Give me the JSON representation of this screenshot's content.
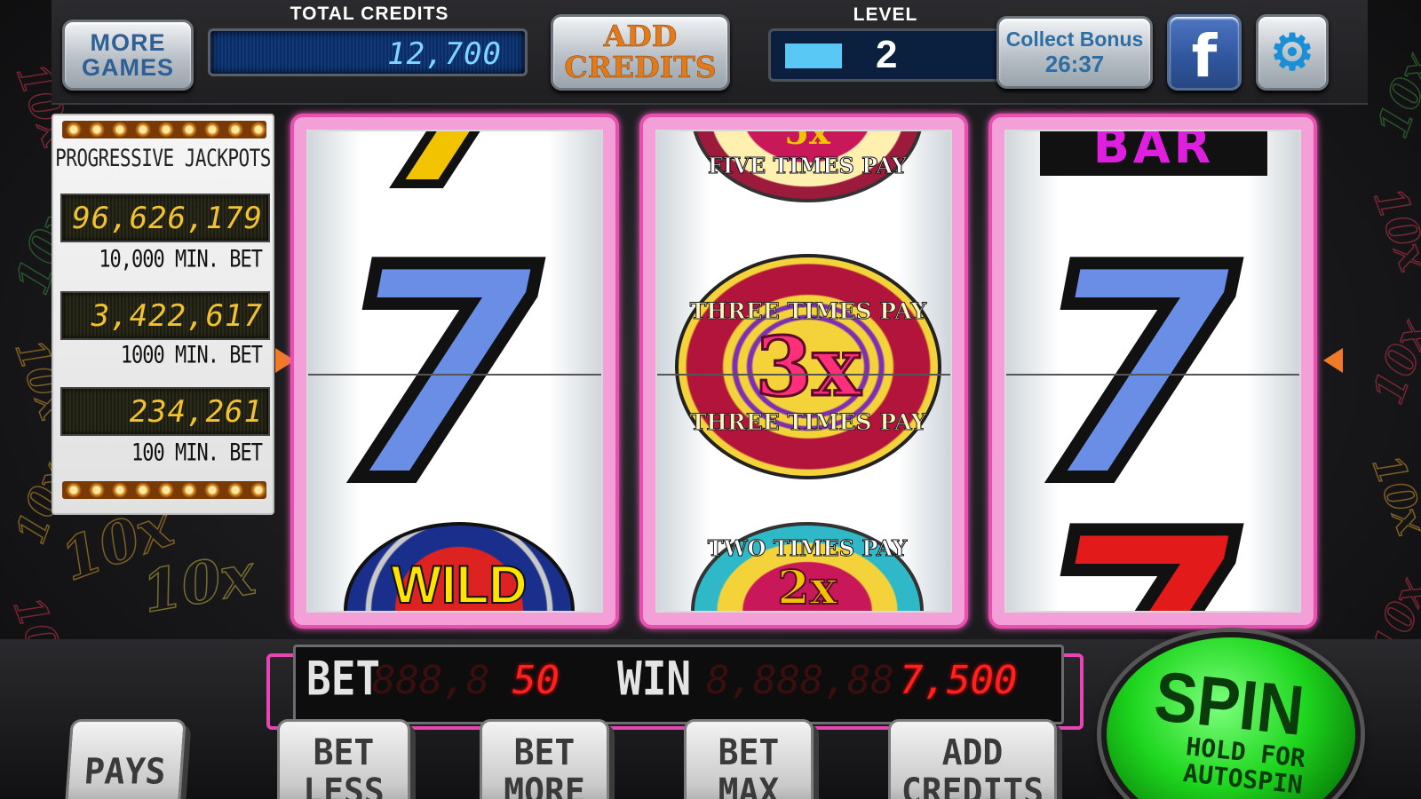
{
  "header": {
    "more_games": "MORE\nGAMES",
    "total_credits_label": "TOTAL CREDITS",
    "total_credits_value": "12,700",
    "add_credits": "ADD\nCREDITS",
    "level_label": "LEVEL",
    "level_value": "2",
    "level_progress": 0.25,
    "collect_bonus_label": "Collect Bonus",
    "collect_bonus_timer": "26:37",
    "facebook_glyph": "f",
    "settings_glyph": "⚙"
  },
  "jackpots": {
    "title": "PROGRESSIVE JACKPOTS",
    "items": [
      {
        "value": "96,626,179",
        "min_bet": "10,000 MIN. BET"
      },
      {
        "value": "3,422,617",
        "min_bet": "1000 MIN. BET"
      },
      {
        "value": "234,261",
        "min_bet": "100 MIN. BET"
      }
    ]
  },
  "reels": {
    "reel1": {
      "top": "7",
      "center": "7",
      "bottom": "WILD"
    },
    "reel2": {
      "top_text": "FIVE TIMES PAY",
      "top_mult": "5x",
      "center_top_text": "THREE TIMES PAY",
      "center_mult": "3x",
      "center_bottom_text": "THREE TIMES PAY",
      "bottom_text": "TWO TIMES PAY",
      "bottom_mult": "2x"
    },
    "reel3": {
      "top": "BAR",
      "center": "7",
      "bottom": "7"
    }
  },
  "background_text": "10x",
  "betwin": {
    "bet_label": "BET",
    "bet_ghost": "888,8",
    "bet_value": "50",
    "win_label": "WIN",
    "win_ghost": "8,888,88",
    "win_value": "7,500"
  },
  "buttons": {
    "pays": "PAYS",
    "bet_less": "BET\nLESS",
    "bet_more": "BET\nMORE",
    "bet_max": "BET\nMAX",
    "add_credits": "ADD\nCREDITS"
  },
  "spin": {
    "label": "SPIN",
    "sub": "HOLD FOR\nAUTOSPIN"
  },
  "colors": {
    "reel_frame": "#e84fae",
    "seven_blue": "#6a8ee6",
    "seven_red": "#e21a1a",
    "spin_green": "#1ed61e"
  }
}
